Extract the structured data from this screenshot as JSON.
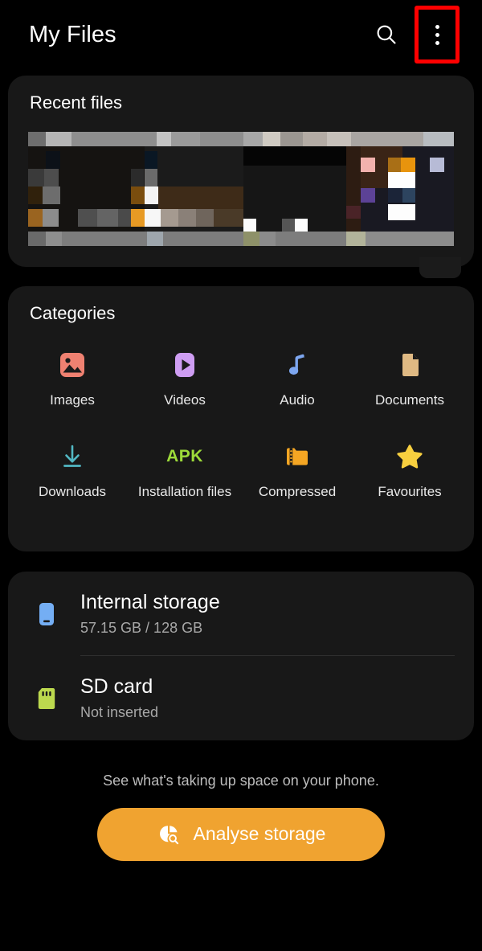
{
  "app": {
    "title": "My Files",
    "background_color": "#000000",
    "card_color": "#181818",
    "highlight_color": "#ff0000"
  },
  "header": {
    "title": "My Files",
    "search_icon": "search-icon",
    "menu_icon": "more-options-icon",
    "menu_highlighted": true
  },
  "recent": {
    "title": "Recent files",
    "thumbnails_blurred": true
  },
  "categories": {
    "title": "Categories",
    "items": [
      {
        "label": "Images",
        "icon": "image-icon",
        "color": "#ef8171"
      },
      {
        "label": "Videos",
        "icon": "video-play-icon",
        "color": "#ce9df2"
      },
      {
        "label": "Audio",
        "icon": "music-note-icon",
        "color": "#7da6ef"
      },
      {
        "label": "Documents",
        "icon": "document-icon",
        "color": "#dfb983"
      },
      {
        "label": "Downloads",
        "icon": "download-icon",
        "color": "#52b8c4"
      },
      {
        "label": "Installation files",
        "icon": "apk-icon",
        "color": "#9ddb3a"
      },
      {
        "label": "Compressed",
        "icon": "zip-folder-icon",
        "color": "#f5a623"
      },
      {
        "label": "Favourites",
        "icon": "star-icon",
        "color": "#f7cf3f"
      }
    ],
    "apk_text": "APK"
  },
  "storage": {
    "items": [
      {
        "name": "Internal storage",
        "detail": "57.15 GB / 128 GB",
        "icon": "phone-icon",
        "color": "#74aef4"
      },
      {
        "name": "SD card",
        "detail": "Not inserted",
        "icon": "sd-card-icon",
        "color": "#bcd94e"
      }
    ]
  },
  "footer": {
    "note": "See what's taking up space on your phone.",
    "button_label": "Analyse storage",
    "button_icon": "analyse-storage-icon",
    "button_color": "#f0a330"
  }
}
